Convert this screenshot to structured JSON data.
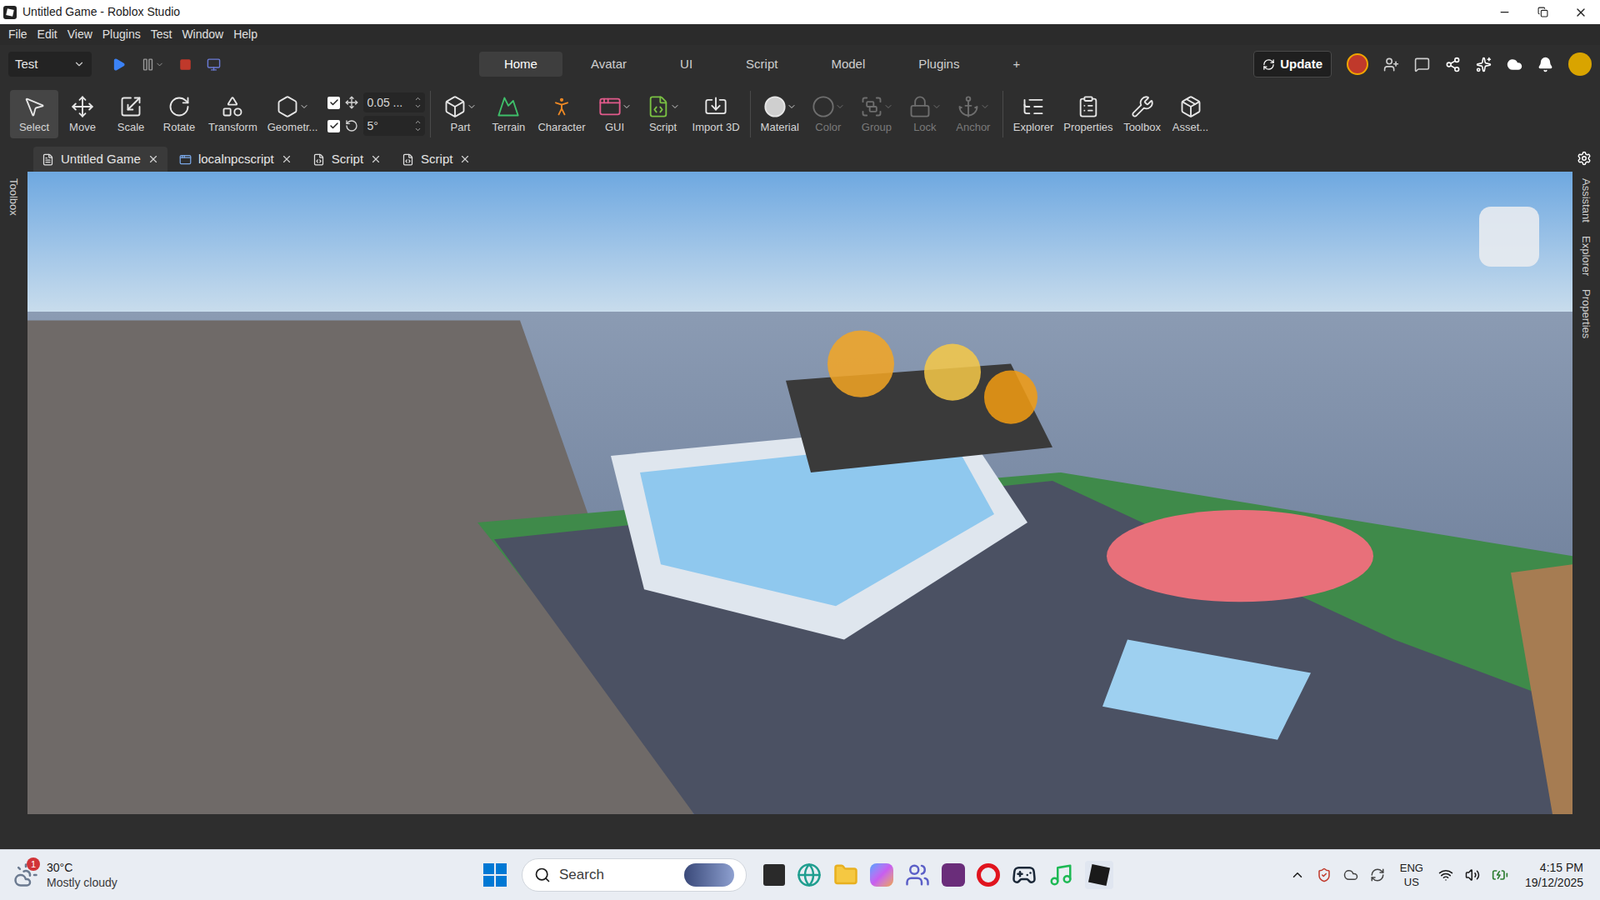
{
  "window": {
    "title": "Untitled Game - Roblox Studio"
  },
  "menu": [
    "File",
    "Edit",
    "View",
    "Plugins",
    "Test",
    "Window",
    "Help"
  ],
  "mode_dropdown": {
    "value": "Test"
  },
  "ribbon_tabs": [
    {
      "label": "Home",
      "selected": true
    },
    {
      "label": "Avatar",
      "selected": false
    },
    {
      "label": "UI",
      "selected": false
    },
    {
      "label": "Script",
      "selected": false
    },
    {
      "label": "Model",
      "selected": false
    },
    {
      "label": "Plugins",
      "selected": false
    },
    {
      "label": "+",
      "selected": false
    }
  ],
  "update_button": {
    "label": "Update"
  },
  "transform_tools": [
    {
      "label": "Select",
      "selected": true
    },
    {
      "label": "Move",
      "selected": false
    },
    {
      "label": "Scale",
      "selected": false
    },
    {
      "label": "Rotate",
      "selected": false
    },
    {
      "label": "Transform",
      "selected": false
    },
    {
      "label": "Geometr...",
      "selected": false
    }
  ],
  "snapping": [
    {
      "checked": true,
      "value": "0.05 ..."
    },
    {
      "checked": true,
      "value": "5°"
    }
  ],
  "insert_tools": [
    {
      "label": "Part"
    },
    {
      "label": "Terrain"
    },
    {
      "label": "Character"
    },
    {
      "label": "GUI"
    },
    {
      "label": "Script"
    },
    {
      "label": "Import 3D"
    }
  ],
  "edit_tools": [
    {
      "label": "Material",
      "disabled": false
    },
    {
      "label": "Color",
      "disabled": true
    },
    {
      "label": "Group",
      "disabled": true
    },
    {
      "label": "Lock",
      "disabled": true
    },
    {
      "label": "Anchor",
      "disabled": true
    }
  ],
  "panel_tools": [
    {
      "label": "Explorer"
    },
    {
      "label": "Properties"
    },
    {
      "label": "Toolbox"
    },
    {
      "label": "Asset..."
    }
  ],
  "doc_tabs": [
    {
      "label": "Untitled Game",
      "selected": true
    },
    {
      "label": "localnpcscript",
      "selected": false
    },
    {
      "label": "Script",
      "selected": false
    },
    {
      "label": "Script",
      "selected": false
    }
  ],
  "side_left": [
    "Toolbox"
  ],
  "side_right": [
    "Assistant",
    "Explorer",
    "Properties"
  ],
  "taskbar": {
    "weather": {
      "temp": "30°C",
      "desc": "Mostly cloudy",
      "badge": "1"
    },
    "search": {
      "placeholder": "Search"
    },
    "language": {
      "line1": "ENG",
      "line2": "US"
    },
    "time": "4:15 PM",
    "date": "19/12/2025"
  }
}
